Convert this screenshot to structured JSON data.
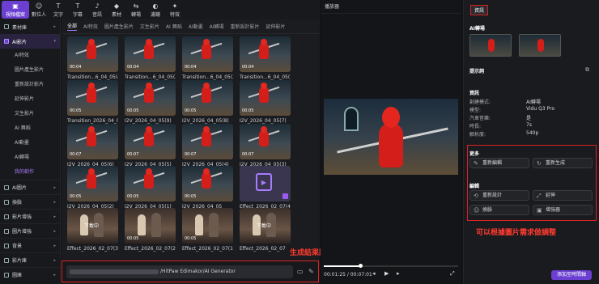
{
  "toolbar": {
    "items": [
      {
        "label": "視頻檔案",
        "icon": "video-file-icon",
        "active": true
      },
      {
        "label": "數位人",
        "icon": "digital-human-icon"
      },
      {
        "label": "文字",
        "icon": "text-icon"
      },
      {
        "label": "字幕",
        "icon": "subtitle-icon"
      },
      {
        "label": "音訊",
        "icon": "audio-icon"
      },
      {
        "label": "素材",
        "icon": "material-icon"
      },
      {
        "label": "轉場",
        "icon": "transition-icon"
      },
      {
        "label": "濾鏡",
        "icon": "filter-icon"
      },
      {
        "label": "特效",
        "icon": "effect-icon"
      }
    ]
  },
  "sidebar": {
    "material_lib": "素材庫",
    "ai_video": "AI影片",
    "ai_video_items": [
      "AI特效",
      "圖片產生影片",
      "重新設計影片",
      "延伸影片",
      "文生影片",
      "AI 舞蹈",
      "AI動畫",
      "AI轉場",
      "我的創作"
    ],
    "groups": [
      "AI圖片",
      "換臉",
      "影片增強",
      "圖片增強",
      "背景",
      "影片庫",
      "圖庫"
    ]
  },
  "media": {
    "tabs": [
      "全部",
      "AI特效",
      "圖片產生影片",
      "文生影片",
      "AI 舞蹈",
      "AI動畫",
      "AI轉場",
      "重新設計影片",
      "延伸影片"
    ],
    "cards": [
      {
        "dur": "00:04",
        "label": "Transition...6_04_05(4)",
        "kind": "robot"
      },
      {
        "dur": "00:04",
        "label": "Transition...6_04_05(3)",
        "kind": "robot"
      },
      {
        "dur": "00:04",
        "label": "Transition...6_04_05(2)",
        "kind": "robot"
      },
      {
        "dur": "00:04",
        "label": "Transition...6_04_05(1)",
        "kind": "robot"
      },
      {
        "dur": "00:05",
        "label": "Transition_2026_04_05",
        "kind": "robot"
      },
      {
        "dur": "00:05",
        "label": "I2V_2026_04_05(9)",
        "kind": "robot"
      },
      {
        "dur": "00:05",
        "label": "I2V_2026_04_05(8)",
        "kind": "robot"
      },
      {
        "dur": "00:05",
        "label": "I2V_2026_04_05(7)",
        "kind": "robot"
      },
      {
        "dur": "00:07",
        "label": "I2V_2026_04_05(6)",
        "kind": "robot"
      },
      {
        "dur": "00:07",
        "label": "I2V_2026_04_05(5)",
        "kind": "robot"
      },
      {
        "dur": "00:07",
        "label": "I2V_2026_04_05(4)",
        "kind": "robot"
      },
      {
        "dur": "00:07",
        "label": "I2V_2026_04_05(3)",
        "kind": "robot"
      },
      {
        "dur": "00:05",
        "label": "I2V_2026_04_05(2)",
        "kind": "robot"
      },
      {
        "dur": "00:05",
        "label": "I2V_2026_04_05(1)",
        "kind": "robot"
      },
      {
        "dur": "00:05",
        "label": "I2V_2026_04_05",
        "kind": "robot"
      },
      {
        "dur": "",
        "label": "Effect_2026_02_07(4)",
        "kind": "generating"
      },
      {
        "dur": "下載中",
        "label": "Effect_2026_02_07(3)",
        "kind": "people"
      },
      {
        "dur": "00:05",
        "label": "Effect_2026_02_07(2)",
        "kind": "people"
      },
      {
        "dur": "00:05",
        "label": "Effect_2026_02_07(1)",
        "kind": "people"
      },
      {
        "dur": "下載中",
        "label": "Effect_2026_02_07",
        "kind": "people"
      }
    ]
  },
  "pathbar": {
    "value": "/HitPaw Edimakor/AI Generator",
    "annotation": "生成結果路徑"
  },
  "player": {
    "title": "播放器",
    "current_time": "00:01:25",
    "total_time": "00:07:01",
    "progress": 0.27
  },
  "rpanel": {
    "tab": "資訊",
    "ai_transition": "AI轉場",
    "prompt_label": "提示詞",
    "info_title": "資訊",
    "info": [
      {
        "k": "創建模式:",
        "v": "AI轉場"
      },
      {
        "k": "模型:",
        "v": "Vidu Q3 Pro"
      },
      {
        "k": "汽車音樂:",
        "v": "是"
      },
      {
        "k": "時長:",
        "v": "7s"
      },
      {
        "k": "解析度:",
        "v": "540p"
      }
    ],
    "more_title": "更多",
    "more_buttons": [
      "重新編輯",
      "重新生成"
    ],
    "edit_title": "編輯",
    "edit_buttons": [
      "重新設計",
      "延伸",
      "換臉",
      "增強器"
    ],
    "annotation": "可以根據圖片需求做調整",
    "export": "添加至時間軸"
  }
}
